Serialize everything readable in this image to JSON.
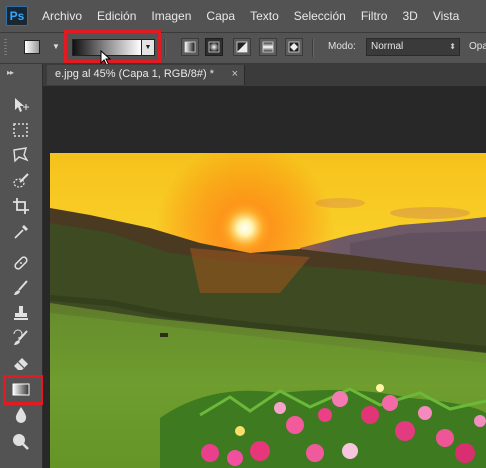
{
  "menubar": {
    "logo": "Ps",
    "items": [
      "Archivo",
      "Edición",
      "Imagen",
      "Capa",
      "Texto",
      "Selección",
      "Filtro",
      "3D",
      "Vista"
    ]
  },
  "options": {
    "mode_label": "Modo:",
    "mode_value": "Normal",
    "opacity_label": "Opa",
    "gradient_types": [
      "linear-gradient-icon",
      "radial-gradient-icon",
      "angle-gradient-icon",
      "reflected-gradient-icon",
      "diamond-gradient-icon"
    ],
    "active_gradient_type": "radial-gradient-icon"
  },
  "document": {
    "tab_title": "e.jpg al 45% (Capa 1, RGB/8#) *",
    "close": "×"
  },
  "toolbar": {
    "tools": [
      "move-icon",
      "marquee-icon",
      "lasso-icon",
      "quick-selection-icon",
      "crop-icon",
      "eyedropper-icon",
      "spot-healing-icon",
      "brush-icon",
      "clone-stamp-icon",
      "history-brush-icon",
      "eraser-icon",
      "gradient-icon",
      "blur-icon",
      "dodge-icon"
    ],
    "active_tool": "gradient-icon"
  },
  "colors": {
    "highlight": "#e21b22",
    "ui_panel": "#535353",
    "pasteboard": "#282828"
  }
}
